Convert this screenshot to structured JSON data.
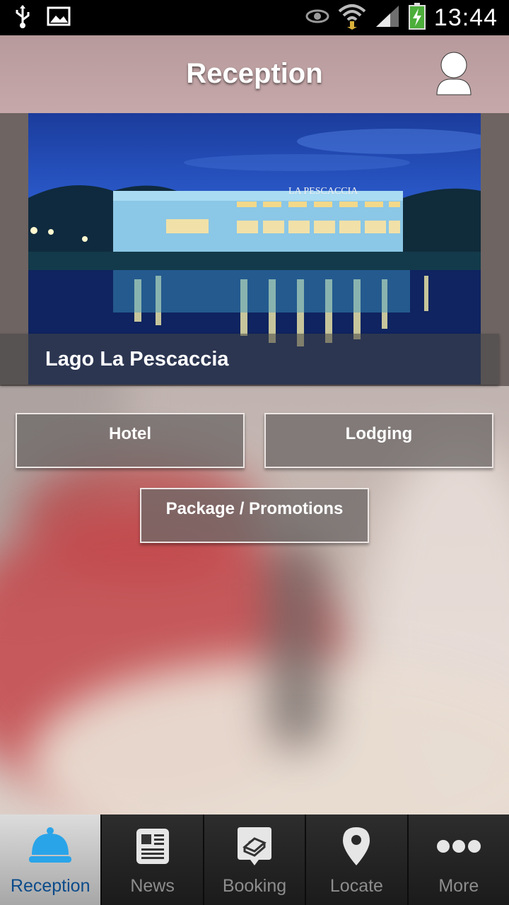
{
  "status_bar": {
    "time": "13:44",
    "icons_left": [
      "usb-icon",
      "image-icon"
    ],
    "icons_right": [
      "eye-icon",
      "wifi-icon",
      "signal-icon",
      "battery-charging-icon"
    ]
  },
  "header": {
    "title": "Reception",
    "profile_icon": "user-icon"
  },
  "hero": {
    "caption": "Lago La Pescaccia",
    "sign_text": "LA PESCACCIA"
  },
  "buttons": {
    "hotel": "Hotel",
    "lodging": "Lodging",
    "package": "Package / Promotions"
  },
  "tabs": [
    {
      "label": "Reception",
      "icon": "reception-bell-icon",
      "active": true
    },
    {
      "label": "News",
      "icon": "news-icon",
      "active": false
    },
    {
      "label": "Booking",
      "icon": "booking-bed-icon",
      "active": false
    },
    {
      "label": "Locate",
      "icon": "location-pin-icon",
      "active": false
    },
    {
      "label": "More",
      "icon": "more-dots-icon",
      "active": false
    }
  ],
  "colors": {
    "accent": "#2aa4e8",
    "active_tab_text": "#0b4b8a"
  }
}
